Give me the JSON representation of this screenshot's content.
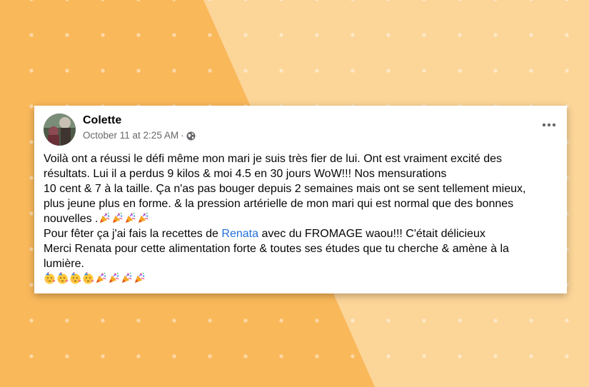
{
  "post": {
    "author": "Colette",
    "timestamp": "October 11 at 2:25 AM",
    "separator": "·",
    "privacy_icon": "globe-icon",
    "more_icon": "more-options-icon",
    "lines": [
      "Voilà ont a réussi le défi même mon mari je suis très fier de lui. Ont est vraiment excité des",
      "résultats. Lui il a perdus 9 kilos & moi 4.5 en 30 jours WoW!!! Nos mensurations",
      "10 cent & 7 à la taille. Ça n'as pas bouger depuis 2 semaines mais ont se sent tellement mieux,",
      "plus jeune plus en forme. & la pression artérielle de mon mari qui est normal que des bonnes",
      "nouvelles ."
    ],
    "line_recipe_before": "Pour fêter ça j'ai fais la recettes de ",
    "line_recipe_link": "Renata",
    "line_recipe_after": " avec du FROMAGE waou!!! C'était délicieux",
    "line_thanks_1": "Merci Renata pour cette alimentation forte & toutes ses études que tu cherche & amène à la",
    "line_thanks_2": "lumière.",
    "emoji_row_1": [
      "party-popper",
      "party-popper",
      "party-popper",
      "party-popper"
    ],
    "emoji_row_2": [
      "partying-face",
      "partying-face",
      "partying-face",
      "partying-face",
      "party-popper",
      "party-popper",
      "party-popper",
      "party-popper"
    ]
  },
  "colors": {
    "background_light": "#fcd598",
    "background_orange": "#f9b85a",
    "link": "#216fdb",
    "meta_text": "#65676b"
  }
}
